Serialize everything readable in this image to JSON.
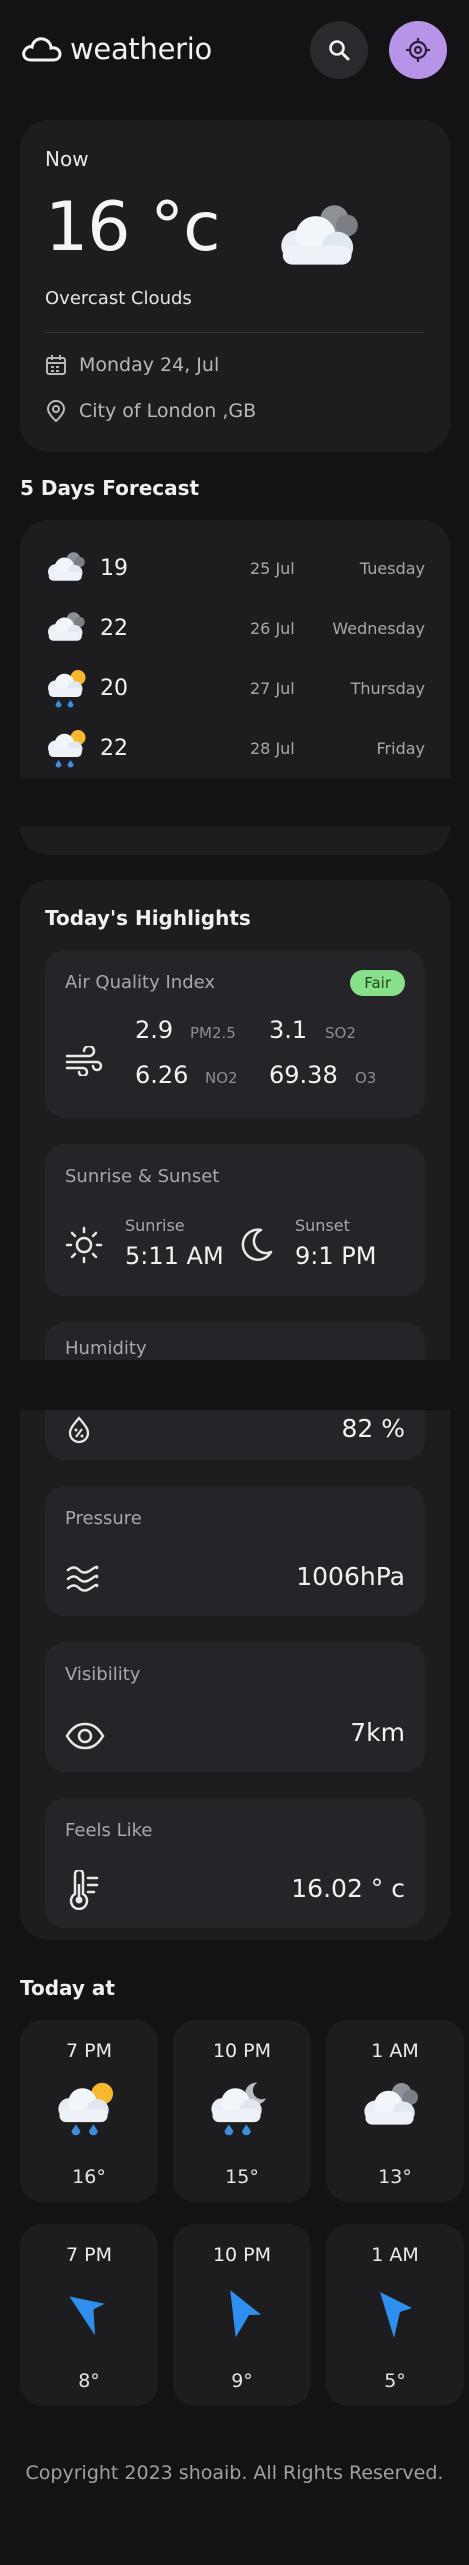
{
  "app": {
    "title": "weatherio"
  },
  "header": {
    "search_icon": "search-icon",
    "location_icon": "crosshair-icon",
    "accent": "#b794e8"
  },
  "current": {
    "label": "Now",
    "temp": "16 °c",
    "condition": "Overcast Clouds",
    "date": "Monday 24, Jul",
    "location": "City of London ,GB"
  },
  "forecast": {
    "title": "5 Days Forecast",
    "days": [
      {
        "icon": "cloud-icon",
        "temp": "19",
        "date": "25 Jul",
        "day": "Tuesday"
      },
      {
        "icon": "cloud-icon",
        "temp": "22",
        "date": "26 Jul",
        "day": "Wednesday"
      },
      {
        "icon": "sun-rain-icon",
        "temp": "20",
        "date": "27 Jul",
        "day": "Thursday"
      },
      {
        "icon": "sun-rain-icon",
        "temp": "22",
        "date": "28 Jul",
        "day": "Friday"
      }
    ]
  },
  "highlights": {
    "title": "Today's Highlights",
    "aqi": {
      "label": "Air Quality Index",
      "badge": "Fair",
      "badge_color": "#89e08a",
      "pm25": "2.9",
      "pm25_label": "PM2.5",
      "so2": "3.1",
      "so2_label": "SO2",
      "no2": "6.26",
      "no2_label": "NO2",
      "o3": "69.38",
      "o3_label": "O3"
    },
    "sun": {
      "label": "Sunrise & Sunset",
      "sunrise_label": "Sunrise",
      "sunrise": "5:11 AM",
      "sunset_label": "Sunset",
      "sunset": "9:1 PM"
    },
    "humidity": {
      "label": "Humidity",
      "value": "82 %"
    },
    "pressure": {
      "label": "Pressure",
      "value": "1006hPa"
    },
    "visibility": {
      "label": "Visibility",
      "value": "7km"
    },
    "feels_like": {
      "label": "Feels Like",
      "value": "16.02 ° c"
    }
  },
  "today": {
    "title": "Today at",
    "weather": [
      {
        "time": "7 PM",
        "icon": "sun-rain-icon",
        "temp": "16°"
      },
      {
        "time": "10 PM",
        "icon": "moon-rain-icon",
        "temp": "15°"
      },
      {
        "time": "1 AM",
        "icon": "cloud-icon",
        "temp": "13°"
      }
    ],
    "wind": [
      {
        "time": "7 PM",
        "icon": "wind-direction-icon",
        "temp": "8°"
      },
      {
        "time": "10 PM",
        "icon": "wind-direction-icon",
        "temp": "9°"
      },
      {
        "time": "1 AM",
        "icon": "wind-direction-icon",
        "temp": "5°"
      }
    ]
  },
  "footer": {
    "copyright": "Copyright 2023 shoaib. All Rights Reserved."
  }
}
